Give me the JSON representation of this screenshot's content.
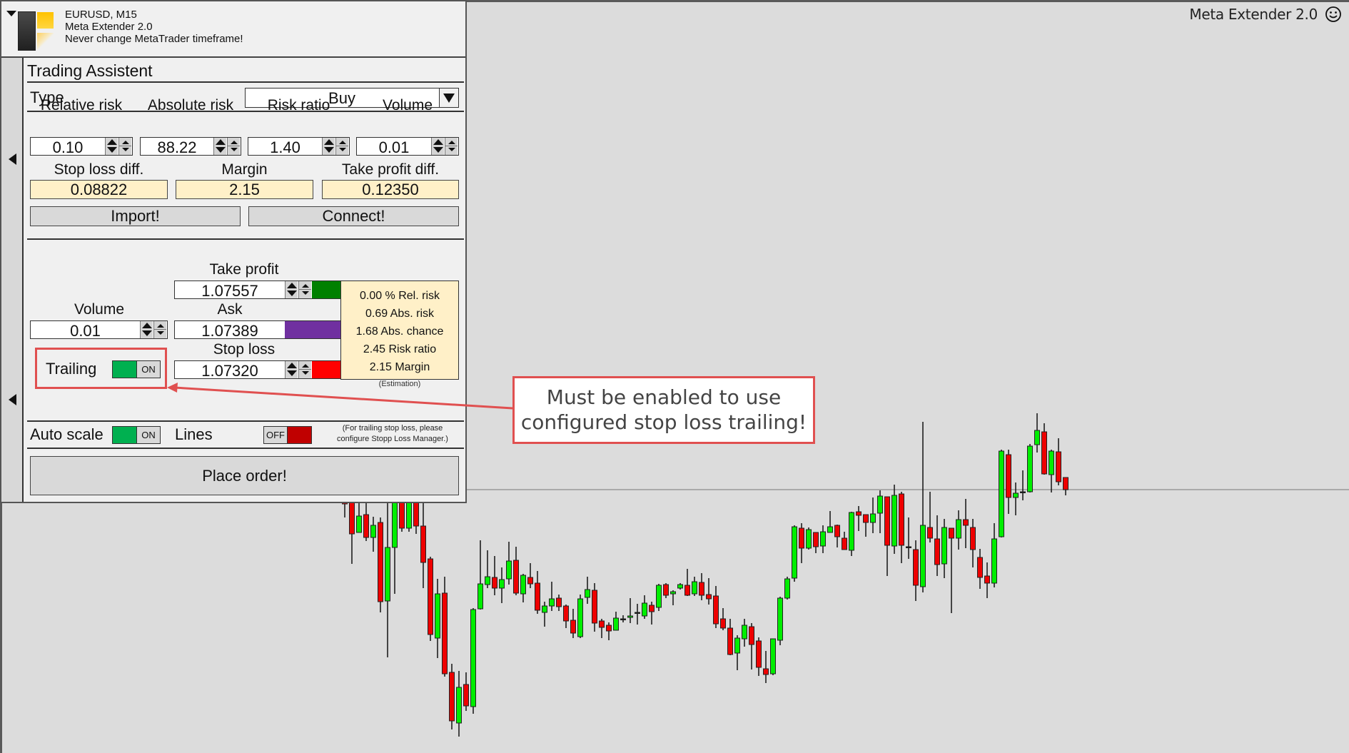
{
  "window": {
    "brand_topright": "Meta Extender 2.0",
    "smiley_icon": "smiley-face-icon"
  },
  "panel": {
    "header": {
      "symbol_timeframe": "EURUSD, M15",
      "product": "Meta Extender 2.0",
      "warning": "Never change MetaTrader timeframe!"
    },
    "section_title": "Trading Assistent",
    "type": {
      "label": "Type",
      "value": "Buy"
    },
    "risk_fields": [
      {
        "label": "Relative risk",
        "value": "0.10"
      },
      {
        "label": "Absolute risk",
        "value": "88.22"
      },
      {
        "label": "Risk ratio",
        "value": "1.40"
      },
      {
        "label": "Volume",
        "value": "0.01"
      }
    ],
    "calc_fields": [
      {
        "label": "Stop loss diff.",
        "value": "0.08822"
      },
      {
        "label": "Margin",
        "value": "2.15"
      },
      {
        "label": "Take profit diff.",
        "value": "0.12350"
      }
    ],
    "buttons": {
      "import": "Import!",
      "connect": "Connect!",
      "place_order": "Place order!"
    },
    "order": {
      "take_profit_label": "Take profit",
      "take_profit_value": "1.07557",
      "volume_label": "Volume",
      "volume_value": "0.01",
      "ask_label": "Ask",
      "ask_value": "1.07389",
      "stop_loss_label": "Stop loss",
      "stop_loss_value": "1.07320",
      "trailing_label": "Trailing",
      "trailing_state": "ON",
      "colors": {
        "take_profit": "#008000",
        "ask": "#7030a0",
        "stop_loss": "#ff0000"
      }
    },
    "estimation": {
      "lines": [
        "0.00 % Rel. risk",
        "0.69 Abs. risk",
        "1.68 Abs. chance",
        "2.45 Risk ratio",
        "2.15 Margin"
      ],
      "caption": "(Estimation)"
    },
    "options": {
      "auto_scale_label": "Auto scale",
      "auto_scale_state": "ON",
      "lines_label": "Lines",
      "lines_state": "OFF",
      "note_line1": "(For trailing stop loss, please",
      "note_line2": "configure Stopp Loss Manager.)"
    }
  },
  "annotation": {
    "line1": "Must be enabled to use",
    "line2": "configured stop loss trailing!",
    "color": "#e05050"
  },
  "chart_data": {
    "type": "candlestick",
    "symbol": "EURUSD",
    "timeframe": "M15",
    "ylim": [
      1.0702,
      1.08075
    ],
    "price_line": 1.07389,
    "colors": {
      "up": "#00ee00",
      "down": "#ee0000",
      "wick": "#111111",
      "background": "#dcdcdc",
      "price_line": "#aaaaaa"
    },
    "candles_ohlc": [
      [
        1.07372,
        1.07372,
        1.0735,
        1.07369
      ],
      [
        1.07372,
        1.07372,
        1.07285,
        1.07327
      ],
      [
        1.07329,
        1.07372,
        1.07329,
        1.07352
      ],
      [
        1.07354,
        1.07372,
        1.07317,
        1.07322
      ],
      [
        1.07322,
        1.07351,
        1.07302,
        1.07339
      ],
      [
        1.07343,
        1.0735,
        1.07217,
        1.07232
      ],
      [
        1.07233,
        1.07372,
        1.07154,
        1.07308
      ],
      [
        1.07308,
        1.07372,
        1.07243,
        1.07372
      ],
      [
        1.07372,
        1.07372,
        1.0733,
        1.07335
      ],
      [
        1.07335,
        1.07372,
        1.0733,
        1.07372
      ],
      [
        1.07372,
        1.07372,
        1.07327,
        1.07338
      ],
      [
        1.07338,
        1.07372,
        1.07251,
        1.07287
      ],
      [
        1.07292,
        1.07295,
        1.07177,
        1.07186
      ],
      [
        1.07181,
        1.07264,
        1.07153,
        1.07243
      ],
      [
        1.07244,
        1.07267,
        1.07127,
        1.07131
      ],
      [
        1.07133,
        1.07145,
        1.07053,
        1.07065
      ],
      [
        1.07062,
        1.07135,
        1.07043,
        1.07112
      ],
      [
        1.07116,
        1.07133,
        1.07079,
        1.07086
      ],
      [
        1.07085,
        1.07223,
        1.07075,
        1.07221
      ],
      [
        1.07222,
        1.07318,
        1.07221,
        1.07257
      ],
      [
        1.07256,
        1.07304,
        1.07251,
        1.07267
      ],
      [
        1.07266,
        1.07296,
        1.07241,
        1.07251
      ],
      [
        1.07251,
        1.0728,
        1.0723,
        1.07263
      ],
      [
        1.07264,
        1.07316,
        1.07256,
        1.07289
      ],
      [
        1.0729,
        1.07309,
        1.07241,
        1.07244
      ],
      [
        1.07243,
        1.07271,
        1.07231,
        1.07269
      ],
      [
        1.07266,
        1.07286,
        1.07251,
        1.07257
      ],
      [
        1.07258,
        1.07275,
        1.07215,
        1.0722
      ],
      [
        1.07217,
        1.07232,
        1.07197,
        1.07226
      ],
      [
        1.07226,
        1.0726,
        1.07219,
        1.07236
      ],
      [
        1.07237,
        1.07242,
        1.07219,
        1.07225
      ],
      [
        1.07226,
        1.07228,
        1.07195,
        1.07205
      ],
      [
        1.07206,
        1.07222,
        1.07181,
        1.07188
      ],
      [
        1.07183,
        1.07242,
        1.07181,
        1.07236
      ],
      [
        1.07238,
        1.07267,
        1.07229,
        1.07249
      ],
      [
        1.07248,
        1.07258,
        1.0719,
        1.07202
      ],
      [
        1.07205,
        1.07208,
        1.07181,
        1.07196
      ],
      [
        1.07199,
        1.07203,
        1.07178,
        1.07191
      ],
      [
        1.07192,
        1.07218,
        1.07192,
        1.07209
      ],
      [
        1.07208,
        1.07213,
        1.07203,
        1.07208
      ],
      [
        1.0721,
        1.07237,
        1.07202,
        1.07212
      ],
      [
        1.07217,
        1.07229,
        1.072,
        1.07217
      ],
      [
        1.07212,
        1.07241,
        1.07208,
        1.0723
      ],
      [
        1.07227,
        1.07232,
        1.072,
        1.07218
      ],
      [
        1.07224,
        1.07257,
        1.07219,
        1.07255
      ],
      [
        1.07256,
        1.07258,
        1.07237,
        1.07241
      ],
      [
        1.07243,
        1.07248,
        1.07227,
        1.07246
      ],
      [
        1.07251,
        1.07258,
        1.07249,
        1.07256
      ],
      [
        1.07255,
        1.07278,
        1.0724,
        1.07241
      ],
      [
        1.07243,
        1.07267,
        1.0724,
        1.0726
      ],
      [
        1.07259,
        1.07272,
        1.07234,
        1.07241
      ],
      [
        1.07242,
        1.07265,
        1.07228,
        1.07236
      ],
      [
        1.0724,
        1.07254,
        1.07195,
        1.07201
      ],
      [
        1.07208,
        1.07223,
        1.07192,
        1.07195
      ],
      [
        1.07195,
        1.07208,
        1.07157,
        1.07158
      ],
      [
        1.0716,
        1.07185,
        1.07136,
        1.07181
      ],
      [
        1.0718,
        1.07208,
        1.07169,
        1.07199
      ],
      [
        1.07197,
        1.07202,
        1.07137,
        1.07172
      ],
      [
        1.07177,
        1.07182,
        1.07128,
        1.0714
      ],
      [
        1.07138,
        1.07163,
        1.07118,
        1.0713
      ],
      [
        1.07131,
        1.0718,
        1.07129,
        1.0718
      ],
      [
        1.07178,
        1.07239,
        1.07171,
        1.07237
      ],
      [
        1.07237,
        1.07267,
        1.07235,
        1.07264
      ],
      [
        1.07265,
        1.07339,
        1.0726,
        1.07337
      ],
      [
        1.07335,
        1.07342,
        1.07286,
        1.07307
      ],
      [
        1.07307,
        1.07336,
        1.07305,
        1.07333
      ],
      [
        1.07329,
        1.07329,
        1.073,
        1.07309
      ],
      [
        1.0731,
        1.07339,
        1.073,
        1.0733
      ],
      [
        1.07329,
        1.07359,
        1.07329,
        1.07337
      ],
      [
        1.07339,
        1.0734,
        1.07308,
        1.07323
      ],
      [
        1.07321,
        1.0733,
        1.07305,
        1.07305
      ],
      [
        1.07304,
        1.07358,
        1.07296,
        1.07357
      ],
      [
        1.07358,
        1.07366,
        1.07331,
        1.07353
      ],
      [
        1.07354,
        1.07354,
        1.07323,
        1.07343
      ],
      [
        1.07343,
        1.07378,
        1.07328,
        1.07355
      ],
      [
        1.07356,
        1.07388,
        1.07328,
        1.0738
      ],
      [
        1.07379,
        1.07379,
        1.07268,
        1.07311
      ],
      [
        1.0731,
        1.07396,
        1.07299,
        1.07381
      ],
      [
        1.07383,
        1.07386,
        1.07286,
        1.07311
      ],
      [
        1.07309,
        1.0735,
        1.07292,
        1.07309
      ],
      [
        1.07305,
        1.07318,
        1.07233,
        1.07255
      ],
      [
        1.07253,
        1.07484,
        1.07245,
        1.07339
      ],
      [
        1.07336,
        1.07386,
        1.07315,
        1.07321
      ],
      [
        1.0732,
        1.07353,
        1.07268,
        1.07284
      ],
      [
        1.07285,
        1.07348,
        1.07265,
        1.07336
      ],
      [
        1.07335,
        1.07335,
        1.07216,
        1.07321
      ],
      [
        1.07321,
        1.0736,
        1.07305,
        1.07347
      ],
      [
        1.07347,
        1.07376,
        1.07307,
        1.07339
      ],
      [
        1.07336,
        1.07348,
        1.0728,
        1.07305
      ],
      [
        1.07294,
        1.07306,
        1.0725,
        1.07266
      ],
      [
        1.07268,
        1.07287,
        1.07237,
        1.07258
      ],
      [
        1.07258,
        1.07342,
        1.07252,
        1.0732
      ],
      [
        1.07323,
        1.07445,
        1.07322,
        1.07443
      ],
      [
        1.07438,
        1.07445,
        1.07355,
        1.07378
      ],
      [
        1.07378,
        1.07399,
        1.07353,
        1.07384
      ],
      [
        1.07386,
        1.07416,
        1.07374,
        1.07386
      ],
      [
        1.07386,
        1.07453,
        1.07385,
        1.0745
      ],
      [
        1.07452,
        1.07496,
        1.07441,
        1.07472
      ],
      [
        1.0747,
        1.07482,
        1.0741,
        1.07411
      ],
      [
        1.0741,
        1.07445,
        1.07385,
        1.07443
      ],
      [
        1.07442,
        1.07461,
        1.07395,
        1.074
      ],
      [
        1.07406,
        1.07406,
        1.07381,
        1.07389
      ]
    ]
  }
}
